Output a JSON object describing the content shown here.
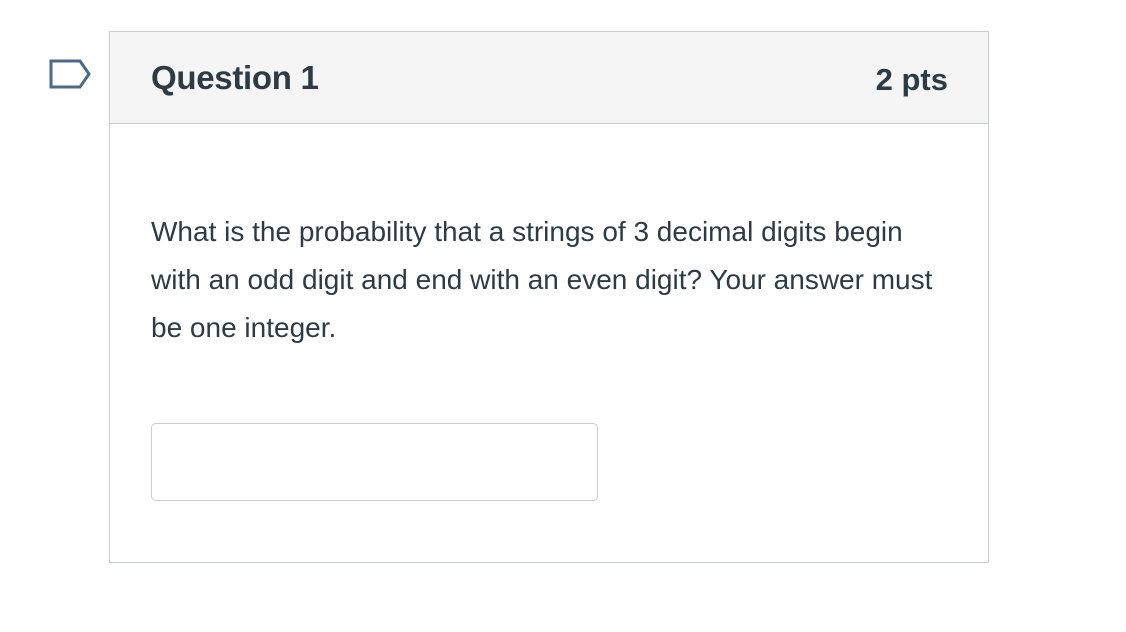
{
  "flag": {
    "icon": "flag-bookmark-icon",
    "color": "#4a6a86"
  },
  "question": {
    "title": "Question 1",
    "points": "2 pts",
    "text": "What is the probability that a strings of 3 decimal digits begin with an odd digit and end with an even digit? Your answer must be one integer.",
    "answer": {
      "value": "",
      "placeholder": ""
    }
  },
  "colors": {
    "header_background": "#f5f5f5",
    "border": "#c7cdd1",
    "text": "#2d3b45"
  }
}
